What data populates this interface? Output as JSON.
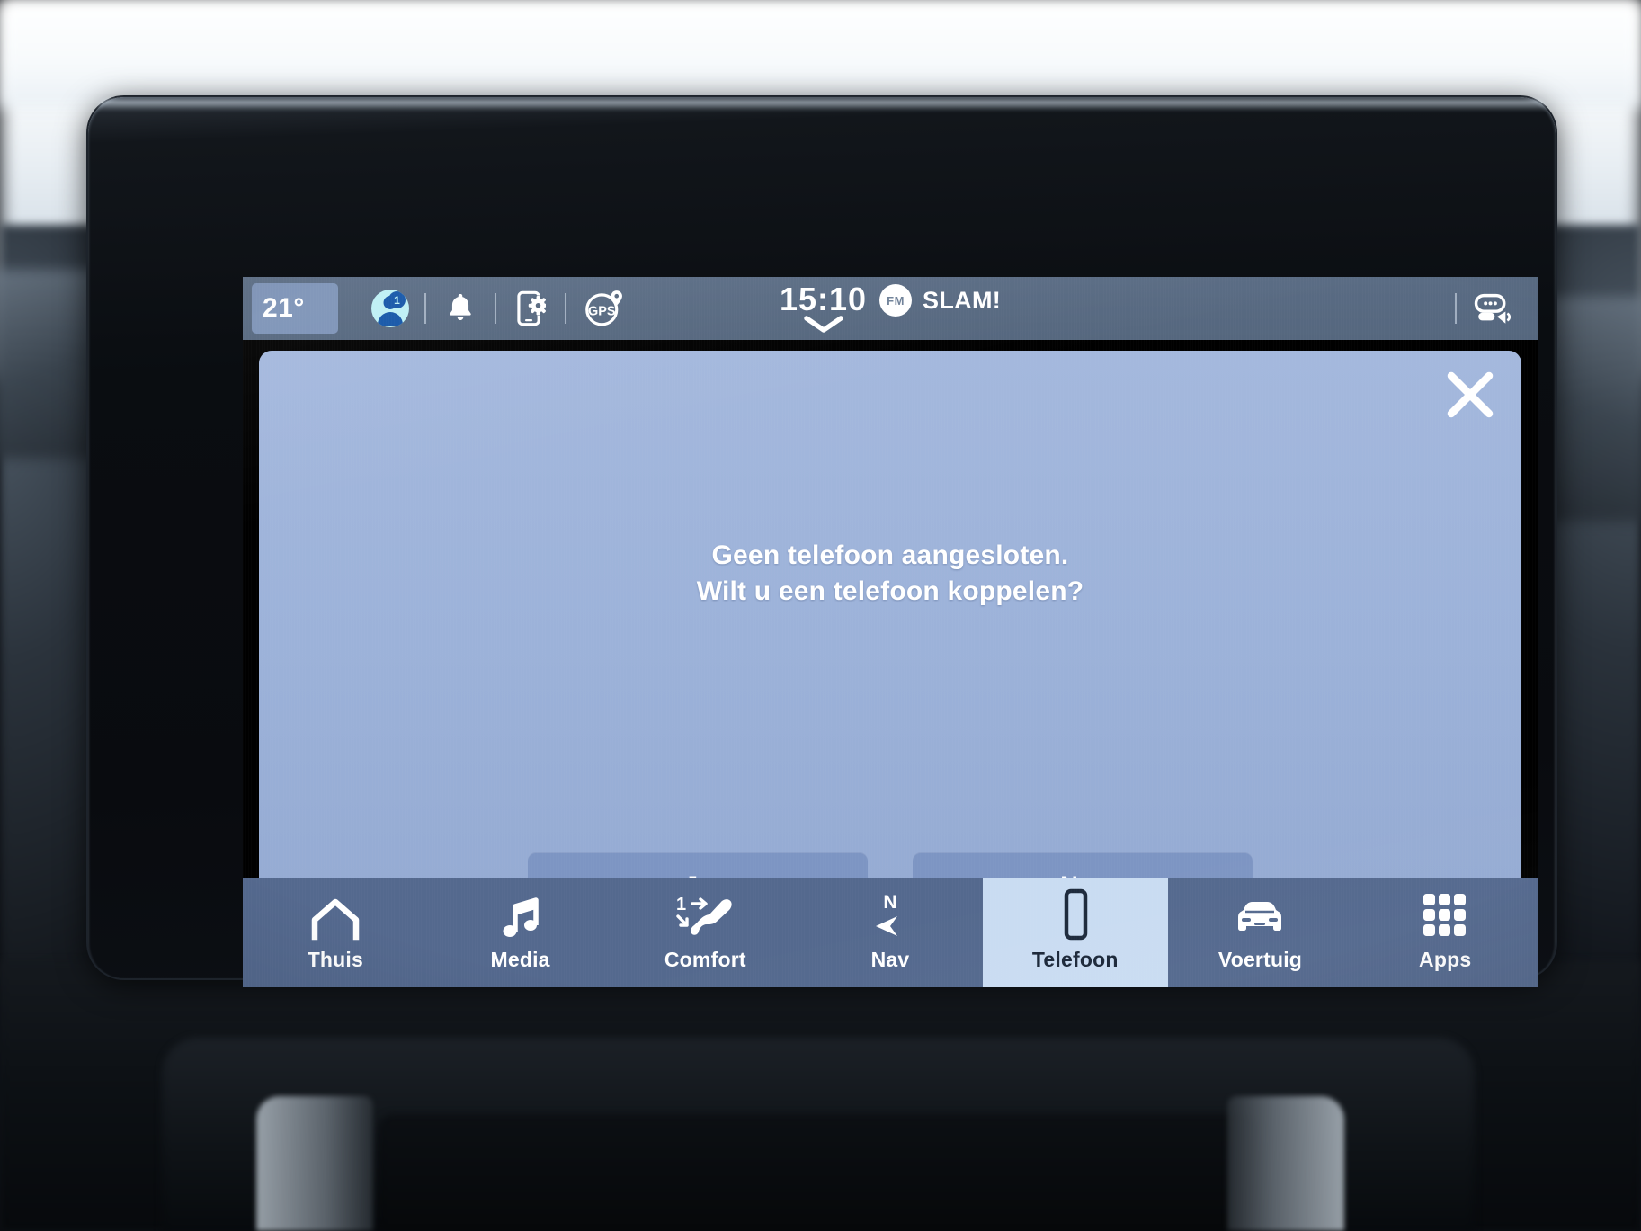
{
  "statusbar": {
    "temperature": "21°",
    "clock": "15:10",
    "radio_band": "FM",
    "radio_station": "SLAM!",
    "icons": {
      "profile": "user-profile-icon",
      "profile_badge": "1",
      "notifications": "bell-icon",
      "phone_settings": "phone-settings-icon",
      "gps": "GPS",
      "voice_assistant": "voice-assistant-icon",
      "expand": "chevron-down-icon"
    }
  },
  "dialog": {
    "close_label": "×",
    "message_line1": "Geen telefoon aangesloten.",
    "message_line2": "Wilt u een telefoon koppelen?",
    "buttons": [
      {
        "label": "Ja",
        "name": "yes-button"
      },
      {
        "label": "Nee",
        "name": "no-button"
      }
    ]
  },
  "navbar": {
    "items": [
      {
        "label": "Thuis",
        "icon": "home-icon",
        "active": false
      },
      {
        "label": "Media",
        "icon": "music-note-icon",
        "active": false
      },
      {
        "label": "Comfort",
        "icon": "seat-icon",
        "active": false
      },
      {
        "label": "Nav",
        "icon": "compass-icon",
        "active": false
      },
      {
        "label": "Telefoon",
        "icon": "phone-icon",
        "active": true
      },
      {
        "label": "Voertuig",
        "icon": "car-icon",
        "active": false
      },
      {
        "label": "Apps",
        "icon": "grid-icon",
        "active": false
      }
    ]
  },
  "colors": {
    "statusbar_bg": "#55677e",
    "dialog_bg": "#9cb2d9",
    "dialog_button_bg": "#7d95c3",
    "navbar_bg": "#54698e",
    "navbar_active_bg": "#c9dcf2",
    "accent_cyan": "#bdf0f5",
    "accent_blue": "#1456a8",
    "text_on_blue": "#ffffff"
  }
}
